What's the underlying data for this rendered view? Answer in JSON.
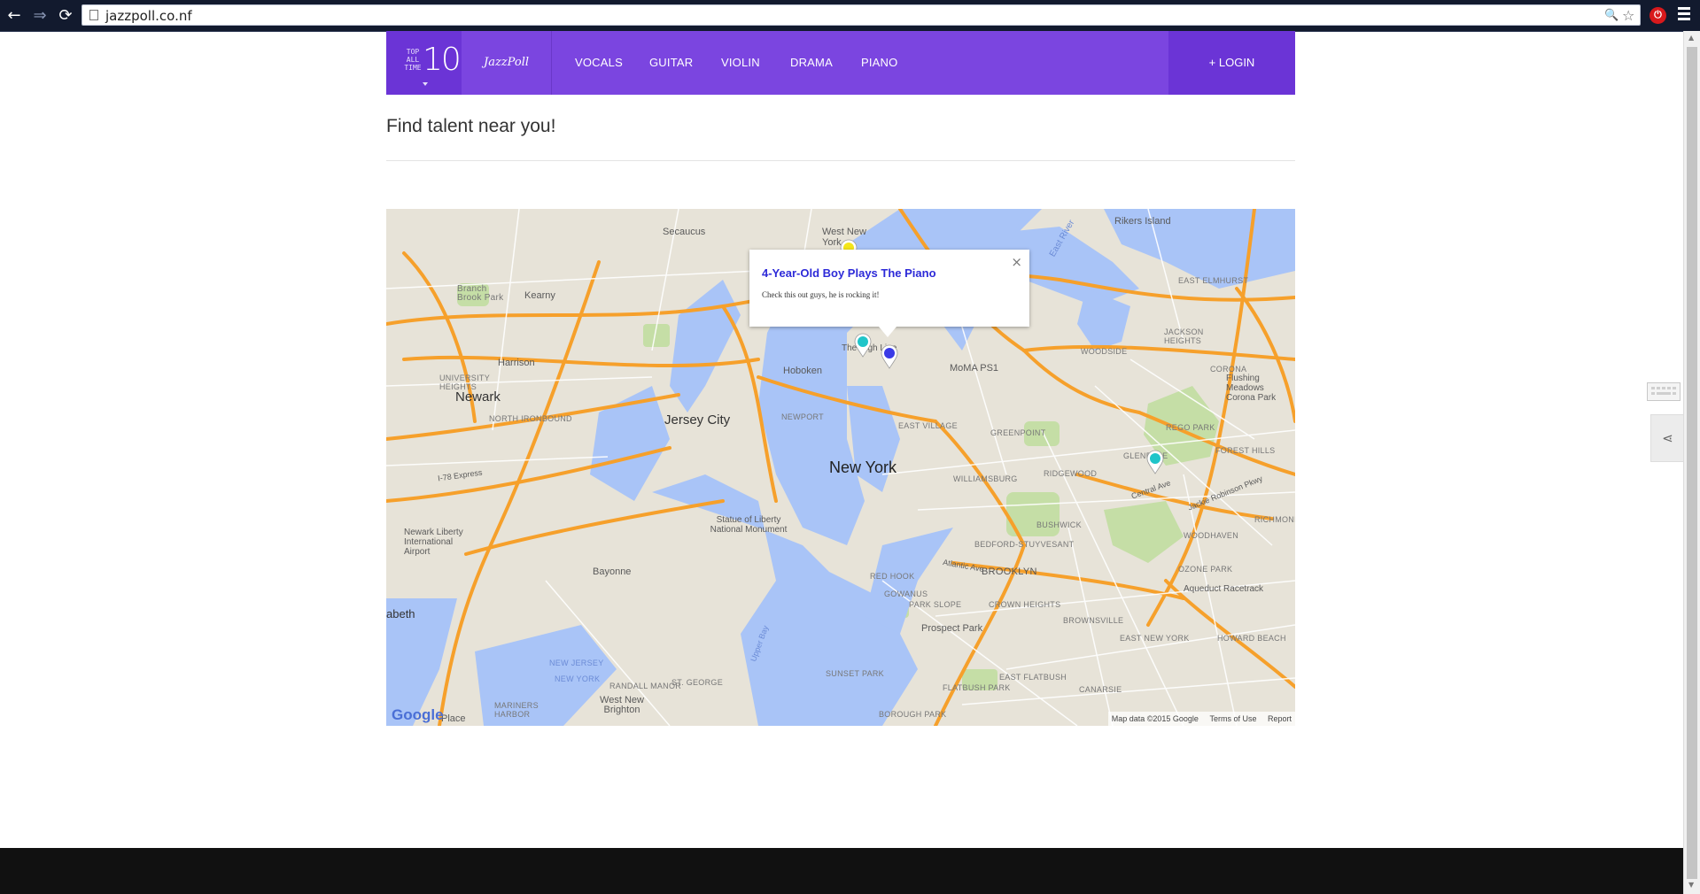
{
  "browser": {
    "url": "jazzpoll.co.nf",
    "back": "←",
    "forward": "⇒",
    "reload": "⟳",
    "search_glyph": "🔍",
    "star_glyph": "☆",
    "extension_glyph": "⏻"
  },
  "nav": {
    "badge_small": "TOP ALL TIME",
    "badge_number": "10",
    "logo": "JazzPoll",
    "links": [
      "VOCALS",
      "GUITAR",
      "VIOLIN",
      "DRAMA",
      "PIANO"
    ],
    "login": "+ LOGIN",
    "accent_color": "#7b45e0",
    "accent_dark": "#6b34d6"
  },
  "page": {
    "heading": "Find talent near you!"
  },
  "map": {
    "google": "Google",
    "footer": {
      "data": "Map data ©2015 Google",
      "terms": "Terms of Use",
      "report": "Report"
    },
    "places": {
      "secaucus": "Secaucus",
      "west_new_york": "West New York",
      "rikers": "Rikers Island",
      "kearny": "Kearny",
      "branch_brook": "Branch Brook Park",
      "harrison": "Harrison",
      "newark": "Newark",
      "north_ironbound": "NORTH IRONBOUND",
      "hoboken": "Hoboken",
      "high_line": "The High Line",
      "moma": "MoMA PS1",
      "jersey_city": "Jersey City",
      "newport": "NEWPORT",
      "east_village": "EAST VILLAGE",
      "greenpoint": "GREENPOINT",
      "new_york": "New York",
      "williamsburg": "WILLIAMSBURG",
      "jackson_heights": "JACKSON HEIGHTS",
      "woodside": "WOODSIDE",
      "east_elmhurst": "EAST ELMHURST",
      "corona": "CORONA",
      "flushing_meadows": "Flushing Meadows Corona Park",
      "rego_park": "REGO PARK",
      "glendale": "GLENDALE",
      "ridgewood": "RIDGEWOOD",
      "forest_hills": "FOREST HILLS",
      "statue_liberty": "Statue of Liberty National Monument",
      "newark_airport": "Newark Liberty International Airport",
      "bushwick": "BUSHWICK",
      "bedford": "BEDFORD-STUYVESANT",
      "brooklyn": "BROOKLYN",
      "woodhaven": "WOODHAVEN",
      "red_hook": "RED HOOK",
      "gowanus": "GOWANUS",
      "park_slope": "PARK SLOPE",
      "crown_heights": "CROWN HEIGHTS",
      "brownsville": "BROWNSVILLE",
      "east_new_york": "EAST NEW YORK",
      "prospect_park": "Prospect Park",
      "bayonne": "Bayonne",
      "west_new_brighton": "West New Brighton",
      "sunset_park": "SUNSET PARK",
      "flatbush": "FLATBUSH",
      "east_flatbush": "EAST FLATBUSH",
      "canarsie": "CANARSIE",
      "aqueduct": "Aqueduct Racetrack",
      "ozone_park": "OZONE PARK",
      "howard_beach": "HOWARD BEACH",
      "richmond": "RICHMOND",
      "new_jersey": "NEW JERSEY",
      "new_york_water": "NEW YORK",
      "upper_bay": "Upper Bay",
      "elizabeth": "abeth",
      "place": "Place",
      "randall_manor": "RANDALL MANOR",
      "st_george": "ST. GEORGE",
      "borough_park": "BOROUGH PARK",
      "flatbush_ave": "FLATBUSH PARK",
      "bergen": "UNIVERSITY HEIGHTS",
      "east_river": "East River",
      "jackie": "Jackie Robinson Pkwy",
      "atlantic_ave": "Atlantic Ave",
      "central_ave": "Central Ave",
      "express": "I-78 Express",
      "mariners": "MARINERS HARBOR",
      "new_york_bay": "NEW YORK"
    },
    "popup": {
      "title": "4-Year-Old Boy Plays The Piano",
      "text": "Check this out guys, he is rocking it!",
      "close": "×"
    },
    "markers": [
      {
        "name": "yellow",
        "color": "#f4e61b"
      },
      {
        "name": "teal",
        "color": "#1fc5c9"
      },
      {
        "name": "blue",
        "color": "#3a3ae6"
      },
      {
        "name": "teal",
        "color": "#1fc5c9"
      }
    ],
    "colors": {
      "land": "#e7e3d8",
      "water": "#a9c4f7",
      "park": "#c5dea6",
      "highway": "#f6a02b",
      "road": "#ffffff"
    }
  },
  "side": {
    "share_glyph": "⋖",
    "scroll_up": "▲",
    "scroll_down": "▼"
  }
}
